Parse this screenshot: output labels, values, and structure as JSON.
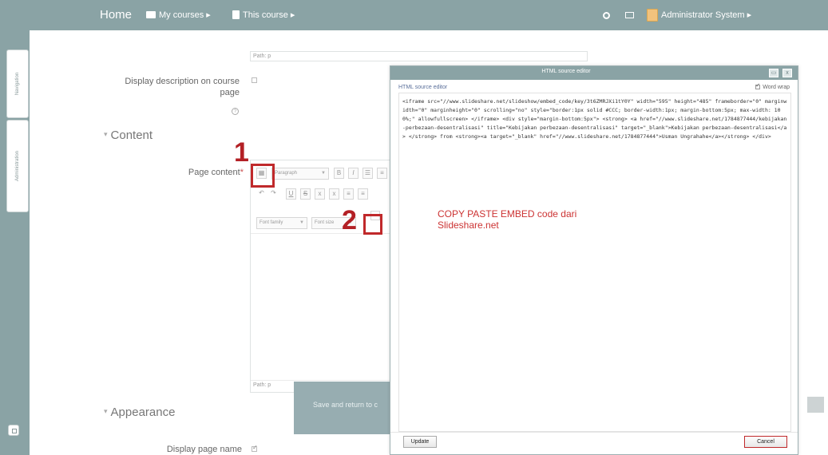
{
  "navbar": {
    "home": "Home",
    "my_courses": "My courses ▸",
    "this_course": "This course ▸",
    "user": "Administrator System ▸"
  },
  "side_tabs": {
    "navigation": "Navigation",
    "administration": "Administration"
  },
  "form": {
    "path_top": "Path: p",
    "display_description_label_line1": "Display description on course",
    "display_description_label_line2": "page",
    "content_section": "Content",
    "page_content_label": "Page content",
    "required_star": "*",
    "paragraph_select": "Paragraph",
    "font_family_select": "Font family",
    "font_size_select": "Font size",
    "path_bottom": "Path: p",
    "save_button": "Save and return to c",
    "appearance_section": "Appearance",
    "display_page_name_label": "Display page name"
  },
  "toolbar": {
    "bold": "B",
    "italic": "I",
    "underline": "U",
    "strike": "S",
    "html_icon": "html-source-icon"
  },
  "annotations": {
    "num1": "1",
    "num2": "2",
    "note_line1": "COPY PASTE EMBED code dari",
    "note_line2": "Slideshare.net",
    "color": "#c0292b"
  },
  "dialog": {
    "title": "HTML source editor",
    "inner_title": "HTML source editor",
    "word_wrap": "Word wrap",
    "code": "<iframe src=\"//www.slideshare.net/slideshow/embed_code/key/3t6ZMRJXi1tY0Y\" width=\"595\" height=\"485\" frameborder=\"0\" marginwidth=\"0\" marginheight=\"0\" scrolling=\"no\" style=\"border:1px solid #CCC; border-width:1px; margin-bottom:5px; max-width: 100%;\" allowfullscreen> </iframe> <div style=\"margin-bottom:5px\"> <strong> <a href=\"//www.slideshare.net/1784877444/kebijakan-perbezaan-desentralisasi\" title=\"Kebijakan perbezaan-desentralisasi\" target=\"_blank\">Kebijakan perbezaan-desentralisasi</a> </strong> from <strong><a target=\"_blank\" href=\"//www.slideshare.net/1784877444\">Usman Ungrahahe</a></strong> </div>",
    "update_button": "Update",
    "cancel_button": "Cancel",
    "minimize_glyph": "▭",
    "close_glyph": "x"
  }
}
